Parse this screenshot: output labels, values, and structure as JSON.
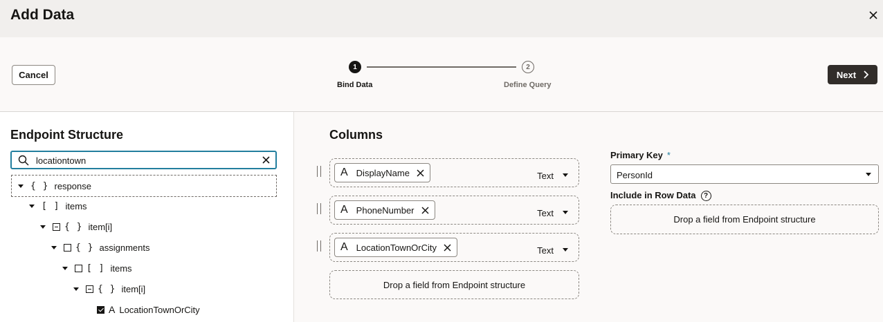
{
  "dialog": {
    "title": "Add Data"
  },
  "wizard": {
    "cancel_label": "Cancel",
    "next_label": "Next",
    "steps": [
      {
        "number": "1",
        "label": "Bind Data",
        "state": "current"
      },
      {
        "number": "2",
        "label": "Define Query",
        "state": "upcoming"
      }
    ]
  },
  "endpoint": {
    "heading": "Endpoint Structure",
    "search_value": "locationtown",
    "tree": [
      {
        "symbol": "{ }",
        "label": "response",
        "checkbox": "none"
      },
      {
        "symbol": "[ ]",
        "label": "items",
        "checkbox": "none"
      },
      {
        "symbol": "{ }",
        "label": "item[i]",
        "checkbox": "mixed"
      },
      {
        "symbol": "{ }",
        "label": "assignments",
        "checkbox": "empty"
      },
      {
        "symbol": "[ ]",
        "label": "items",
        "checkbox": "empty"
      },
      {
        "symbol": "{ }",
        "label": "item[i]",
        "checkbox": "mixed"
      },
      {
        "symbol": "A",
        "label": "LocationTownOrCity",
        "checkbox": "checked"
      }
    ]
  },
  "columns": {
    "heading": "Columns",
    "items": [
      {
        "field": "DisplayName",
        "type": "Text"
      },
      {
        "field": "PhoneNumber",
        "type": "Text"
      },
      {
        "field": "LocationTownOrCity",
        "type": "Text"
      }
    ],
    "drop_text": "Drop a field from Endpoint structure"
  },
  "primary_key": {
    "label": "Primary Key",
    "required_mark": "*",
    "value": "PersonId"
  },
  "row_data": {
    "label": "Include in Row Data",
    "help": "?",
    "drop_text": "Drop a field from Endpoint structure"
  },
  "colors": {
    "accent": "#227e9e",
    "primary_button": "#312d2a",
    "header_bg": "#f1efed"
  }
}
